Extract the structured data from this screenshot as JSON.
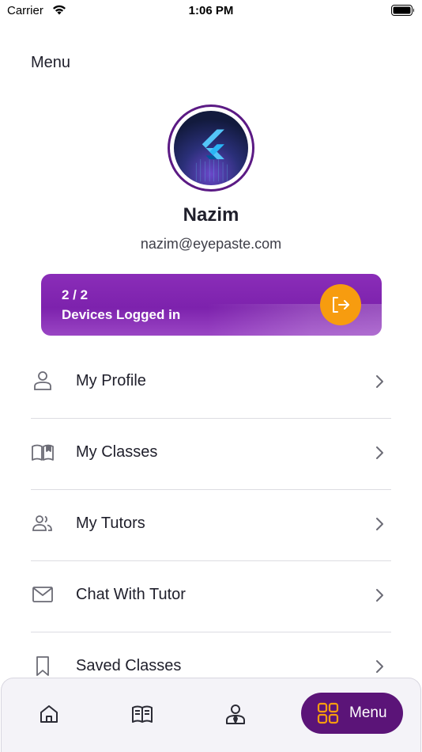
{
  "status_bar": {
    "carrier": "Carrier",
    "time": "1:06 PM"
  },
  "header": {
    "title": "Menu"
  },
  "profile": {
    "name": "Nazim",
    "email": "nazim@eyepaste.com"
  },
  "devices": {
    "count": "2 / 2",
    "label": "Devices Logged in"
  },
  "menu_items": [
    {
      "label": "My Profile",
      "icon": "user-icon"
    },
    {
      "label": "My Classes",
      "icon": "book-open-icon"
    },
    {
      "label": "My Tutors",
      "icon": "users-icon"
    },
    {
      "label": "Chat With Tutor",
      "icon": "mail-icon"
    },
    {
      "label": "Saved Classes",
      "icon": "bookmark-icon"
    }
  ],
  "bottom_nav": {
    "items": [
      {
        "icon": "home-icon"
      },
      {
        "icon": "book-icon"
      },
      {
        "icon": "tutor-icon"
      }
    ],
    "active": {
      "label": "Menu",
      "icon": "grid-icon"
    }
  },
  "colors": {
    "brand_purple": "#7d22ad",
    "accent_orange": "#f79c0f",
    "nav_active": "#5b1478"
  }
}
